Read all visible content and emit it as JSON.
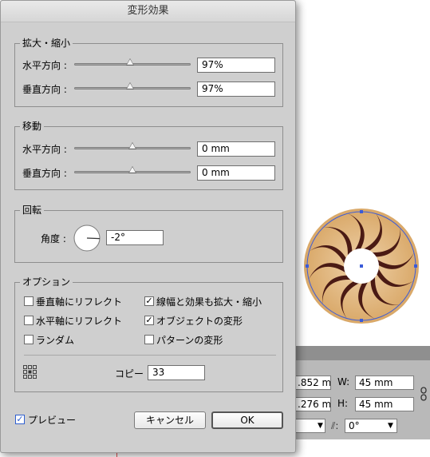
{
  "dialog": {
    "title": "変形効果",
    "scale": {
      "legend": "拡大・縮小",
      "horizontal_label": "水平方向 :",
      "horizontal_value": "97%",
      "horizontal_slider": 0.48,
      "vertical_label": "垂直方向 :",
      "vertical_value": "97%",
      "vertical_slider": 0.48
    },
    "move": {
      "legend": "移動",
      "horizontal_label": "水平方向 :",
      "horizontal_value": "0 mm",
      "horizontal_slider": 0.5,
      "vertical_label": "垂直方向 :",
      "vertical_value": "0 mm",
      "vertical_slider": 0.5
    },
    "rotate": {
      "legend": "回転",
      "angle_label": "角度 :",
      "angle_value": "-2°"
    },
    "options": {
      "legend": "オプション",
      "reflect_vertical": {
        "label": "垂直軸にリフレクト",
        "checked": false
      },
      "reflect_horizontal": {
        "label": "水平軸にリフレクト",
        "checked": false
      },
      "random": {
        "label": "ランダム",
        "checked": false
      },
      "scale_strokes": {
        "label": "線幅と効果も拡大・縮小",
        "checked": true
      },
      "transform_objects": {
        "label": "オブジェクトの変形",
        "checked": true
      },
      "transform_patterns": {
        "label": "パターンの変形",
        "checked": false
      },
      "copies_label": "コピー",
      "copies_value": "33"
    },
    "preview": {
      "label": "プレビュー",
      "checked": true
    },
    "cancel_label": "キャンセル",
    "ok_label": "OK"
  },
  "transform_panel": {
    "x_value": ".852 m",
    "y_value": ".276 m",
    "w_label": "W:",
    "w_value": "45 mm",
    "h_label": "H:",
    "h_value": "45 mm",
    "angle_value": "0°",
    "shear_icon": "shear-icon",
    "link_icon": "link-icon"
  },
  "colors": {
    "dialog_bg": "#cfcfcf",
    "artwork_tan": "#d9a868",
    "artwork_dark": "#4a1a14",
    "selection_blue": "#3a5bd9"
  }
}
